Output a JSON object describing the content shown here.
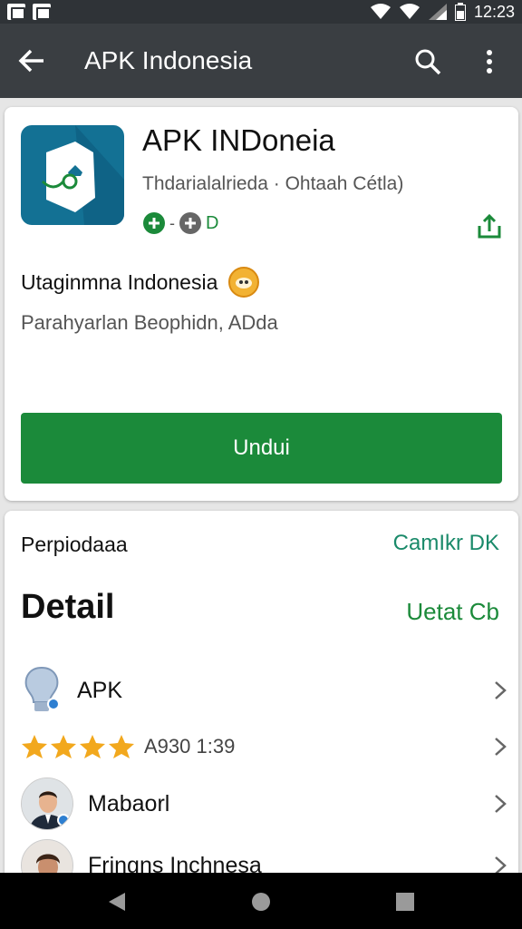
{
  "status_bar": {
    "time": "12:23",
    "icons": [
      "notification-icon",
      "gallery-icon",
      "wifi-icon",
      "signal-icon",
      "sim-icon",
      "battery-icon"
    ]
  },
  "app_bar": {
    "title": "APK Indonesia",
    "icons": [
      "back-arrow-icon",
      "search-icon",
      "more-vert-icon"
    ]
  },
  "app": {
    "name": "APK INDoneia",
    "subtitle": "Thdarialalrieda · Ohtaah Cétla)",
    "badge_text": "- ",
    "badge_suffix": "D",
    "headline": "Utaginmna Indonesia",
    "description": "Parahyarlan Beophidn, ADda",
    "install_label": "Undui",
    "accent_color": "#1b8a3a",
    "icon_color": "#137194"
  },
  "details": {
    "section_label": "Perpiodaaa",
    "section_link": "CamIkr DK",
    "title": "Detail",
    "title_link": "Uetat Cb",
    "items": [
      {
        "label": "APK",
        "icon": "lightbulb-icon"
      },
      {
        "label": "A930 1:39",
        "icon": "star-icon",
        "stars": 4
      },
      {
        "label": "Mabaorl",
        "icon": "avatar"
      },
      {
        "label": "Fringns Inchnesa",
        "icon": "avatar"
      }
    ]
  },
  "nav": {
    "icons": [
      "back-icon",
      "home-icon",
      "recents-icon"
    ]
  }
}
